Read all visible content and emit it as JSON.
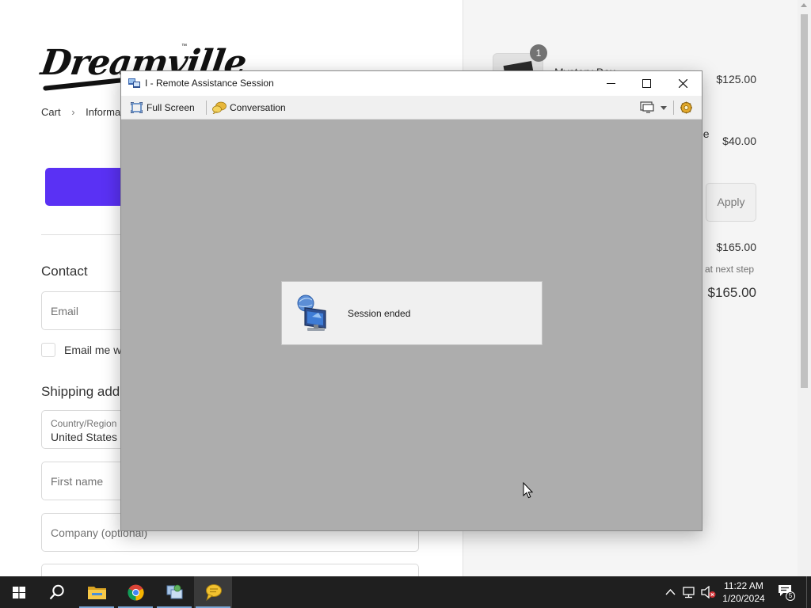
{
  "checkout_page": {
    "logo_text": "Dreamville",
    "logo_tm": "™",
    "breadcrumb": [
      "Cart",
      "Informatio"
    ],
    "contact": {
      "heading": "Contact",
      "email_placeholder": "Email",
      "newsletter_label": "Email me w"
    },
    "shipping": {
      "heading": "Shipping addr",
      "country_label": "Country/Region",
      "country_value": "United States",
      "first_name_placeholder": "First name",
      "company_placeholder": "Company (optional)"
    },
    "express_checkout_color": "#5a31f4"
  },
  "order_summary": {
    "item_quantity": "1",
    "item_name": "Mystery Box",
    "item_price": "$125.00",
    "second_item_name_fragment": "ee",
    "second_item_price": "$40.00",
    "apply_label": "Apply",
    "subtotal": "$165.00",
    "shipping_note": "d at next step",
    "total": "$165.00"
  },
  "remote_assistance": {
    "window_title": "I - Remote Assistance Session",
    "toolbar": {
      "full_screen_label": "Full Screen",
      "conversation_label": "Conversation"
    },
    "status_message": "Session ended"
  },
  "taskbar": {
    "apps": [
      "start-icon",
      "search-icon",
      "file-explorer-icon",
      "chrome-icon",
      "remote-assistance-icon",
      "chat-icon"
    ],
    "time": "11:22 AM",
    "date": "1/20/2024",
    "notification_count": "5"
  }
}
